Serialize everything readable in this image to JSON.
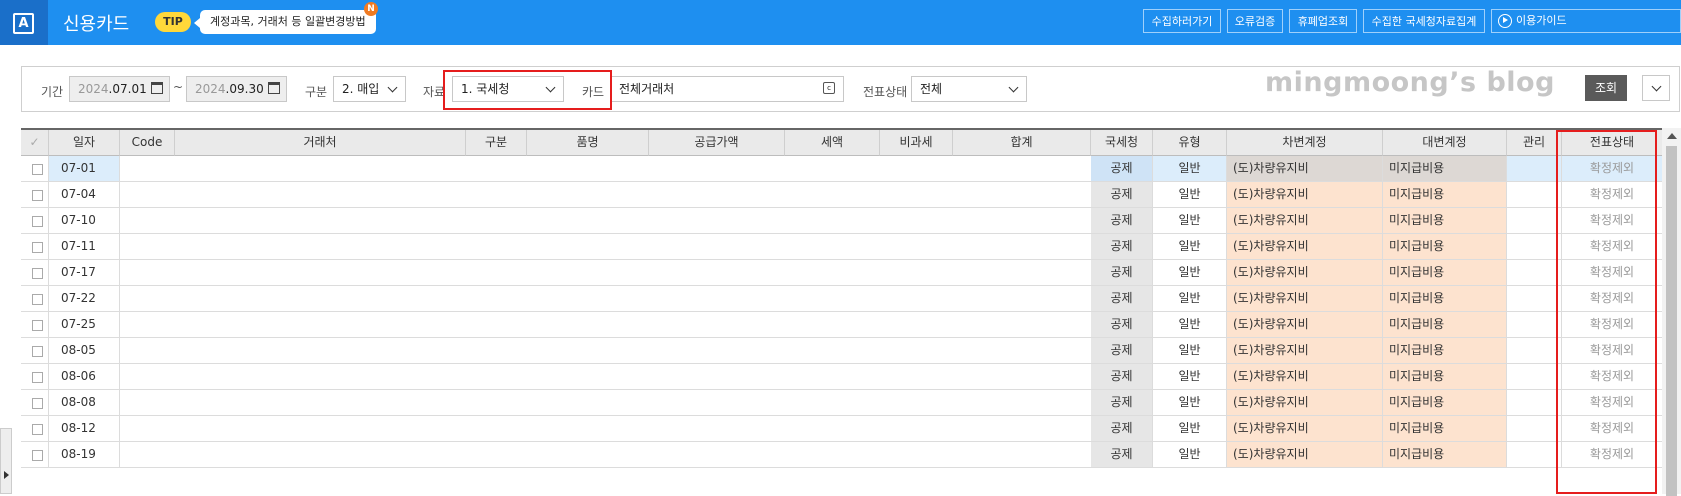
{
  "app": {
    "logo_letter": "A",
    "title": "신용카드",
    "tip_label": "TIP",
    "tip_text": "계정과목, 거래처 등 일괄변경방법",
    "new_badge": "N"
  },
  "top_buttons": [
    "수집하러가기",
    "오류검증",
    "휴폐업조회",
    "수집한 국세청자료집계",
    "이용가이드"
  ],
  "filter": {
    "period_label": "기간",
    "date_from_year": "2024",
    "date_from_rest": ".07.01",
    "tilde": "~",
    "date_to_year": "2024",
    "date_to_rest": ".09.30",
    "type_label": "구분",
    "type_value": "2. 매입",
    "source_label": "자료",
    "source_value": "1. 국세청",
    "card_label": "카드",
    "card_value": "전체거래처",
    "card_icon_char": "c",
    "status_label": "전표상태",
    "status_value": "전체",
    "query_button": "조회"
  },
  "watermark": "mingmoong’s blog",
  "table": {
    "check_all": "✓",
    "headers": [
      "일자",
      "Code",
      "거래처",
      "구분",
      "품명",
      "공급가액",
      "세액",
      "비과세",
      "합계",
      "국세청",
      "유형",
      "차변계정",
      "대변계정",
      "관리",
      "전표상태"
    ],
    "rows": [
      {
        "date": "07-01",
        "nts": "공제",
        "type": "일반",
        "debit": "(도)차량유지비",
        "credit": "미지급비용",
        "status": "확정제외"
      },
      {
        "date": "07-04",
        "nts": "공제",
        "type": "일반",
        "debit": "(도)차량유지비",
        "credit": "미지급비용",
        "status": "확정제외"
      },
      {
        "date": "07-10",
        "nts": "공제",
        "type": "일반",
        "debit": "(도)차량유지비",
        "credit": "미지급비용",
        "status": "확정제외"
      },
      {
        "date": "07-11",
        "nts": "공제",
        "type": "일반",
        "debit": "(도)차량유지비",
        "credit": "미지급비용",
        "status": "확정제외"
      },
      {
        "date": "07-17",
        "nts": "공제",
        "type": "일반",
        "debit": "(도)차량유지비",
        "credit": "미지급비용",
        "status": "확정제외"
      },
      {
        "date": "07-22",
        "nts": "공제",
        "type": "일반",
        "debit": "(도)차량유지비",
        "credit": "미지급비용",
        "status": "확정제외"
      },
      {
        "date": "07-25",
        "nts": "공제",
        "type": "일반",
        "debit": "(도)차량유지비",
        "credit": "미지급비용",
        "status": "확정제외"
      },
      {
        "date": "08-05",
        "nts": "공제",
        "type": "일반",
        "debit": "(도)차량유지비",
        "credit": "미지급비용",
        "status": "확정제외"
      },
      {
        "date": "08-06",
        "nts": "공제",
        "type": "일반",
        "debit": "(도)차량유지비",
        "credit": "미지급비용",
        "status": "확정제외"
      },
      {
        "date": "08-08",
        "nts": "공제",
        "type": "일반",
        "debit": "(도)차량유지비",
        "credit": "미지급비용",
        "status": "확정제외"
      },
      {
        "date": "08-12",
        "nts": "공제",
        "type": "일반",
        "debit": "(도)차량유지비",
        "credit": "미지급비용",
        "status": "확정제외"
      },
      {
        "date": "08-19",
        "nts": "공제",
        "type": "일반",
        "debit": "(도)차량유지비",
        "credit": "미지급비용",
        "status": "확정제외"
      }
    ]
  },
  "colors": {
    "topbar": "#1e8ff0",
    "highlight_frame": "#e51d1d",
    "account_cell_bg": "#fde3cf",
    "selected_row_bg": "#dcedfb"
  }
}
